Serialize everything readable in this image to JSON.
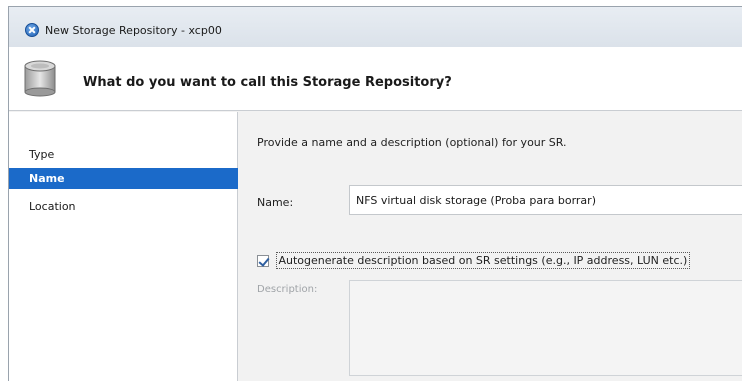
{
  "window": {
    "title": "New Storage Repository - xcp00"
  },
  "header": {
    "title": "What do you want to call this Storage Repository?",
    "icon": "disk-storage-icon"
  },
  "sidebar": {
    "items": [
      {
        "label": "Type",
        "active": false
      },
      {
        "label": "Name",
        "active": true
      },
      {
        "label": "Location",
        "active": false
      }
    ]
  },
  "main": {
    "intro": "Provide a name and a description (optional) for your SR.",
    "name_label": "Name:",
    "name_value": "NFS virtual disk storage (Proba para borrar)",
    "autogen_label": "Autogenerate description based on SR settings (e.g., IP address, LUN etc.)",
    "autogen_checked": true,
    "description_label": "Description:",
    "description_value": ""
  },
  "colors": {
    "accent": "#1b6ac9",
    "panel": "#f2f2f2"
  }
}
